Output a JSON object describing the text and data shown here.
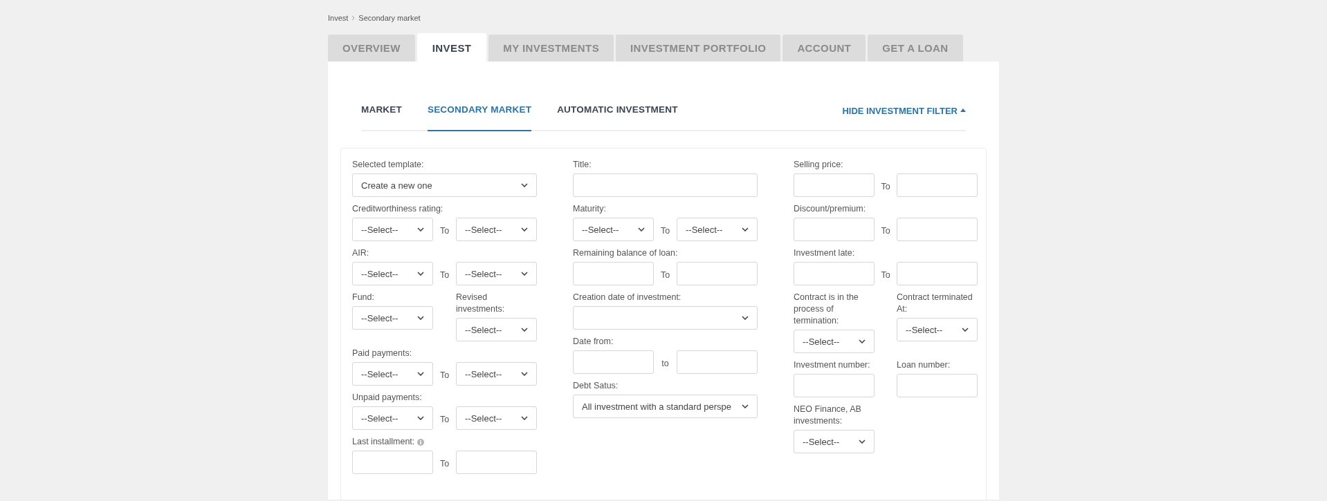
{
  "breadcrumb": [
    {
      "label": "Invest"
    },
    {
      "label": "Secondary market"
    }
  ],
  "tabs": [
    {
      "label": "OVERVIEW",
      "selected": false
    },
    {
      "label": "INVEST",
      "selected": true
    },
    {
      "label": "MY INVESTMENTS",
      "selected": false
    },
    {
      "label": "INVESTMENT PORTFOLIO",
      "selected": false
    },
    {
      "label": "ACCOUNT",
      "selected": false
    },
    {
      "label": "GET A LOAN",
      "selected": false
    }
  ],
  "subtabs": [
    {
      "label": "MARKET",
      "selected": false
    },
    {
      "label": "SECONDARY MARKET",
      "selected": true
    },
    {
      "label": "AUTOMATIC INVESTMENT",
      "selected": false
    }
  ],
  "filter_toggle": {
    "label": "HIDE INVESTMENT FILTER",
    "expanded": true
  },
  "filter_columns": [
    {
      "fields": [
        {
          "kind": "select",
          "label": "Selected template:",
          "value": "Create a new one"
        },
        {
          "kind": "range",
          "label": "Creditworthiness rating:",
          "separator": "To",
          "from": {
            "kind": "select",
            "value": "--Select--"
          },
          "to": {
            "kind": "select",
            "value": "--Select--"
          }
        },
        {
          "kind": "range",
          "label": "AIR:",
          "separator": "To",
          "from": {
            "kind": "select",
            "value": "--Select--"
          },
          "to": {
            "kind": "select",
            "value": "--Select--"
          }
        },
        {
          "kind": "pair",
          "items": [
            {
              "label": "Fund:",
              "control": {
                "kind": "select",
                "value": "--Select--"
              }
            },
            {
              "label": "Revised investments:",
              "control": {
                "kind": "select",
                "value": "--Select--"
              }
            }
          ]
        },
        {
          "kind": "range",
          "label": "Paid payments:",
          "separator": "To",
          "from": {
            "kind": "select",
            "value": "--Select--"
          },
          "to": {
            "kind": "select",
            "value": "--Select--"
          }
        },
        {
          "kind": "range",
          "label": "Unpaid payments:",
          "separator": "To",
          "from": {
            "kind": "select",
            "value": "--Select--"
          },
          "to": {
            "kind": "select",
            "value": "--Select--"
          }
        },
        {
          "kind": "range",
          "label": "Last installment:",
          "info": true,
          "separator": "To",
          "from": {
            "kind": "input"
          },
          "to": {
            "kind": "input"
          }
        }
      ]
    },
    {
      "fields": [
        {
          "kind": "input",
          "label": "Title:"
        },
        {
          "kind": "range",
          "label": "Maturity:",
          "separator": "To",
          "from": {
            "kind": "select",
            "value": "--Select--"
          },
          "to": {
            "kind": "select",
            "value": "--Select--"
          }
        },
        {
          "kind": "range",
          "label": "Remaining balance of loan:",
          "separator": "To",
          "from": {
            "kind": "input"
          },
          "to": {
            "kind": "input"
          }
        },
        {
          "kind": "select",
          "label": "Creation date of investment:"
        },
        {
          "kind": "range",
          "label": "Date from:",
          "separator": "to",
          "from": {
            "kind": "input"
          },
          "to": {
            "kind": "input"
          }
        },
        {
          "kind": "select",
          "label": "Debt Satus:",
          "value": "All investment with a standard perspe"
        }
      ]
    },
    {
      "fields": [
        {
          "kind": "range",
          "label": "Selling price:",
          "separator": "To",
          "from": {
            "kind": "input"
          },
          "to": {
            "kind": "input"
          }
        },
        {
          "kind": "range",
          "label": "Discount/premium:",
          "separator": "To",
          "from": {
            "kind": "input"
          },
          "to": {
            "kind": "input"
          }
        },
        {
          "kind": "range",
          "label": "Investment late:",
          "separator": "To",
          "from": {
            "kind": "input"
          },
          "to": {
            "kind": "input"
          }
        },
        {
          "kind": "pair",
          "items": [
            {
              "label": "Contract is in the process of termination:",
              "control": {
                "kind": "select",
                "value": "--Select--"
              }
            },
            {
              "label": "Contract terminated At:",
              "control": {
                "kind": "select",
                "value": "--Select--"
              }
            }
          ]
        },
        {
          "kind": "pair",
          "items": [
            {
              "label": "Investment number:",
              "control": {
                "kind": "input"
              }
            },
            {
              "label": "Loan number:",
              "control": {
                "kind": "input"
              }
            }
          ]
        },
        {
          "kind": "pair",
          "items": [
            {
              "label": "NEO Finance, AB investments:",
              "control": {
                "kind": "select",
                "value": "--Select--"
              }
            }
          ]
        }
      ]
    }
  ]
}
